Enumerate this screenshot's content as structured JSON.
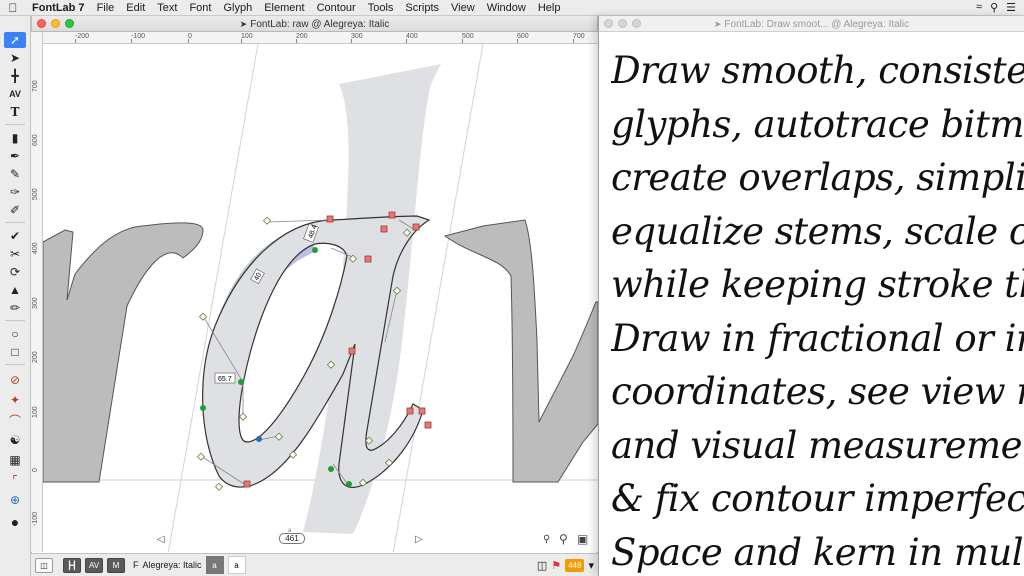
{
  "menubar": {
    "app": "FontLab 7",
    "items": [
      "File",
      "Edit",
      "Text",
      "Font",
      "Glyph",
      "Element",
      "Contour",
      "Tools",
      "Scripts",
      "View",
      "Window",
      "Help"
    ]
  },
  "main_window": {
    "title": "FontLab: raw @ Alegreya: Italic"
  },
  "preview_window": {
    "title": "FontLab: Draw smoot... @ Alegreya: Italic",
    "lines": [
      "Draw smooth, consistent",
      "glyphs, autotrace bitmap",
      "create overlaps, simplify",
      "equalize stems, scale out",
      "while keeping stroke thic",
      "Draw in fractional or int",
      "coordinates, see view nu",
      "and visual measuremen",
      "& fix contour imperfectio",
      "Space and kern in multi-"
    ]
  },
  "rulers": {
    "h_labels": [
      "-200",
      "-100",
      "0",
      "100",
      "200",
      "300",
      "400",
      "500",
      "600",
      "700"
    ],
    "v_labels": [
      "700",
      "600",
      "500",
      "400",
      "300",
      "200",
      "100",
      "0",
      "-100"
    ]
  },
  "canvas": {
    "measure_labels": [
      "48.4",
      "40",
      "65.7"
    ],
    "width_value": "461",
    "glyph_label": "a"
  },
  "statusbar": {
    "font_name": "Alegreya: Italic",
    "font_prefix": "F",
    "btn_metrics": "┣┫",
    "btn_kern": "AV",
    "btn_mode": "M",
    "glyph_current": "a",
    "glyph_next": "a",
    "count": "448"
  },
  "colors": {
    "accent": "#3b82f6",
    "node_green": "#1e9e3a",
    "node_red": "#e05050",
    "badge_orange": "#f59a00"
  }
}
